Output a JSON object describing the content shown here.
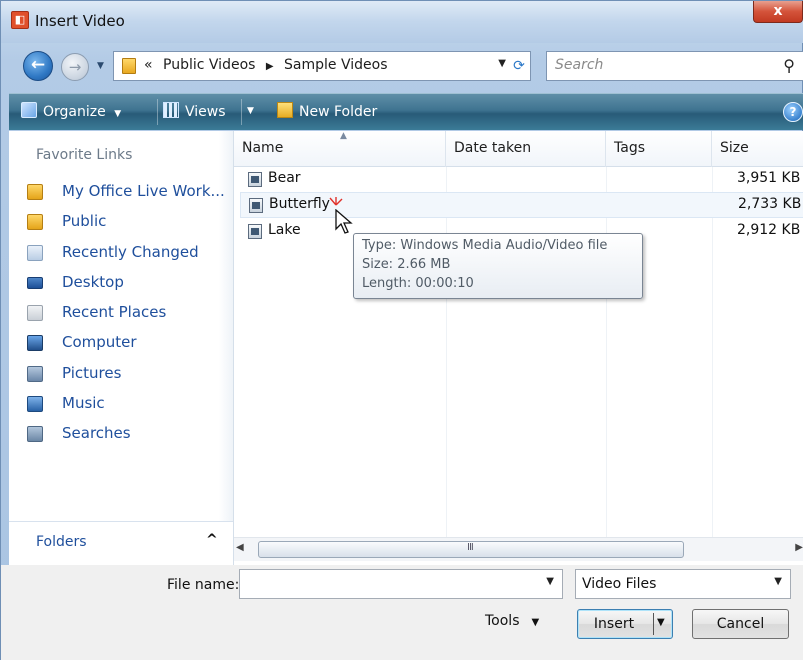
{
  "window": {
    "title": "Insert Video",
    "close_label": "x"
  },
  "address": {
    "crumb_prefix": "«",
    "crumbs": [
      "Public Videos",
      "Sample Videos"
    ],
    "search_placeholder": "Search"
  },
  "toolbar": {
    "organize": "Organize",
    "views": "Views",
    "new_folder": "New Folder",
    "help": "?"
  },
  "sidebar": {
    "title": "Favorite Links",
    "items": [
      {
        "label": "My Office Live Work...",
        "icon": "folder-icon"
      },
      {
        "label": "Public",
        "icon": "folder-icon"
      },
      {
        "label": "Recently Changed",
        "icon": "recently-changed-icon"
      },
      {
        "label": "Desktop",
        "icon": "desktop-icon"
      },
      {
        "label": "Recent Places",
        "icon": "recent-places-icon"
      },
      {
        "label": "Computer",
        "icon": "computer-icon"
      },
      {
        "label": "Pictures",
        "icon": "pictures-icon"
      },
      {
        "label": "Music",
        "icon": "music-icon"
      },
      {
        "label": "Searches",
        "icon": "searches-icon"
      }
    ],
    "folders_label": "Folders"
  },
  "filelist": {
    "columns": [
      "Name",
      "Date taken",
      "Tags",
      "Size"
    ],
    "rows": [
      {
        "name": "Bear",
        "size": "3,951 KB"
      },
      {
        "name": "Butterfly",
        "size": "2,733 KB"
      },
      {
        "name": "Lake",
        "size": "2,912 KB"
      }
    ],
    "tooltip": {
      "type": "Type: Windows Media Audio/Video file",
      "size": "Size: 2.66 MB",
      "length": "Length: 00:00:10"
    },
    "scroll_grip": "III"
  },
  "footer": {
    "file_name_label": "File name:",
    "file_name_value": "",
    "file_type": "Video Files",
    "tools_label": "Tools",
    "insert_label": "Insert",
    "cancel_label": "Cancel"
  },
  "colors": {
    "accent": "#2d6fb3",
    "link": "#1f4f9c",
    "toolbar": "#3e7390"
  }
}
